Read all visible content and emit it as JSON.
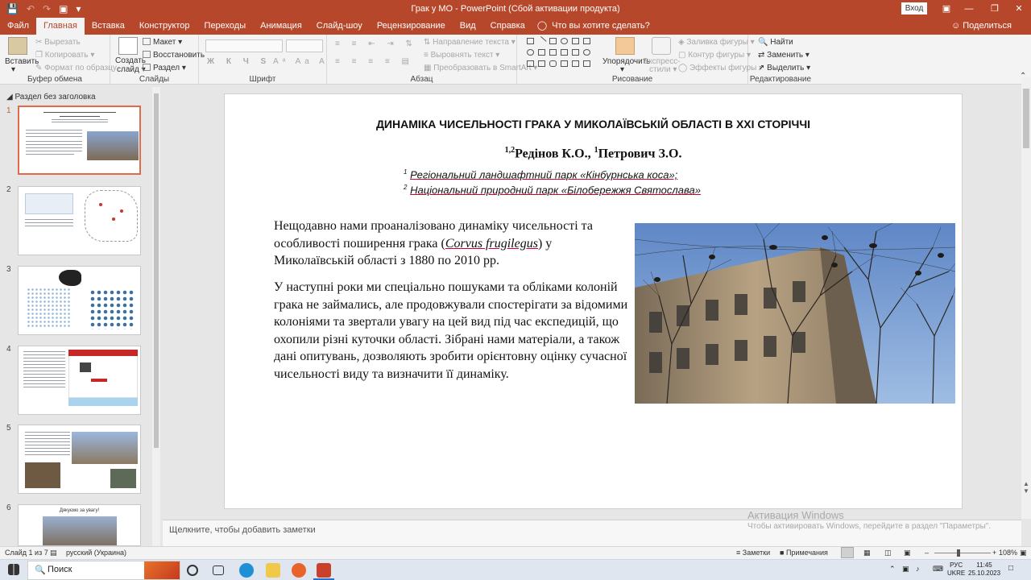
{
  "window": {
    "title": "Грак у МО  -  PowerPoint (Сбой активации продукта)",
    "login": "Вход"
  },
  "tabs": [
    "Файл",
    "Главная",
    "Вставка",
    "Конструктор",
    "Переходы",
    "Анимация",
    "Слайд-шоу",
    "Рецензирование",
    "Вид",
    "Справка"
  ],
  "tell_me": "Что вы хотите сделать?",
  "share": "Поделиться",
  "ribbon": {
    "clipboard": {
      "paste": "Вставить",
      "cut": "Вырезать",
      "copy": "Копировать",
      "format_painter": "Формат по образцу",
      "label": "Буфер обмена"
    },
    "slides": {
      "new_slide": "Создать",
      "new_slide2": "слайд",
      "layout": "Макет",
      "reset": "Восстановить",
      "section": "Раздел",
      "label": "Слайды"
    },
    "font": {
      "label": "Шрифт"
    },
    "paragraph": {
      "text_direction": "Направление текста",
      "align_text": "Выровнять текст",
      "smartart": "Преобразовать в SmartArt",
      "label": "Абзац"
    },
    "drawing": {
      "arrange": "Упорядочить",
      "quick_styles": "Экспресс-",
      "quick_styles2": "стили",
      "shape_fill": "Заливка фигуры",
      "shape_outline": "Контур фигуры",
      "shape_effects": "Эффекты фигуры",
      "label": "Рисование"
    },
    "editing": {
      "find": "Найти",
      "replace": "Заменить",
      "select": "Выделить",
      "label": "Редактирование"
    }
  },
  "left_pane": {
    "section": "Раздел без заголовка",
    "thumbs": [
      "1",
      "2",
      "3",
      "4",
      "5",
      "6"
    ],
    "thumb6_title": "Дякуємо за увагу!"
  },
  "slide": {
    "title": "ДИНАМІКА ЧИСЕЛЬНОСТІ ГРАКА У МИКОЛАЇВСЬКІЙ ОБЛАСТІ В ХХІ СТОРІЧЧІ",
    "authors_sup1": "1,2",
    "authors_name1": "Редінов К.О., ",
    "authors_sup2": "1",
    "authors_name2": "Петрович З.О.",
    "aff1_sup": "1",
    "aff1": "Регіональний ландшафтний парк «Кінбурнська коса»;",
    "aff2_sup": "2",
    "aff2": "Національний природний парк «Білобережжя Святослава»",
    "para1_a": "Нещодавно нами проаналізовано динаміку чисельності та особливості поширення грака (",
    "para1_latin": "Corvus frugilegus",
    "para1_b": ") у Миколаївській області з 1880 по 2010 рр.",
    "para2": "У наступні роки ми спеціально пошуками та обліками колоній грака не займались, але продовжували спостерігати за відомими колоніями та звертали увагу на цей вид під час експедицій, що охопили різні куточки області. Зібрані нами матеріали, а також дані опитувань, дозволяють зробити орієнтовну оцінку сучасної чисельності виду та визначити її динаміку."
  },
  "notes": {
    "placeholder": "Щелкните, чтобы добавить заметки",
    "activation_title": "Активация Windows",
    "activation_text": "Чтобы активировать Windows, перейдите в раздел \"Параметры\"."
  },
  "status": {
    "slide_counter": "Слайд 1 из 7",
    "language": "русский (Украина)",
    "notes_btn": "Заметки",
    "comments_btn": "Примечания",
    "zoom": "108%"
  },
  "taskbar": {
    "search": "Поиск",
    "lang1": "РУС",
    "lang2": "UKRE",
    "time": "11:45",
    "date": "25.10.2023"
  }
}
